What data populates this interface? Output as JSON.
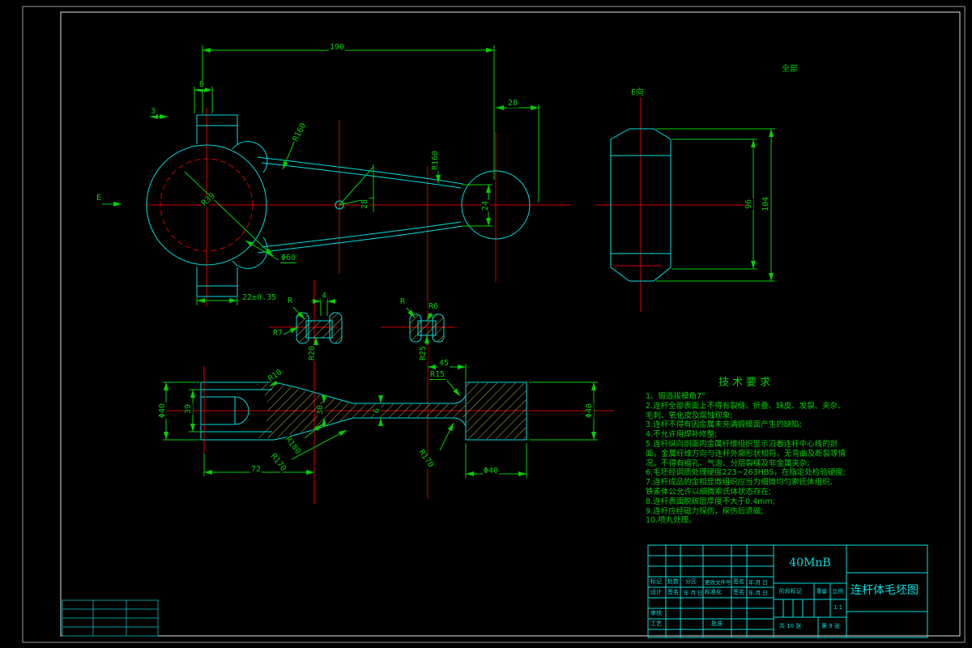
{
  "canvas": {
    "surface_note": "全部"
  },
  "front": {
    "len": "190",
    "boss_top": "8",
    "boss_step": "3",
    "small_off": "28",
    "big_boss": "22±0.35",
    "small_w": "24",
    "shank_taper": "28",
    "r_big": "R39",
    "r_shank_top": "R160",
    "r_shank_bot": "R160",
    "bore": "Φ60",
    "view_arrow": "E"
  },
  "eview": {
    "name": "E向",
    "across": "96",
    "total": "104"
  },
  "secl": {
    "r": "R",
    "web": "4",
    "r7": "R7",
    "r20": "R20"
  },
  "secr": {
    "r": "R",
    "r6": "R6",
    "r25": "R25"
  },
  "bottom": {
    "d_left": "Φ40",
    "fork": "39",
    "r10": "R10",
    "h1": "30",
    "h2": "6",
    "r180": "R180",
    "r170a": "R170",
    "span": "72",
    "off": "45",
    "r15": "R15",
    "r170b": "R170",
    "d_bot": "Φ40",
    "d_right": "Φ40"
  },
  "tech": {
    "title": "技术要求",
    "lines": [
      "1、锻造拔模角7°",
      "2.连杆全部表面上不得有裂缝、折叠、缺皮、发裂、夹杂、",
      "毛刺、氧化皮及腐蚀现象;",
      "3.连杆不得有因金属未充满锻模面产生的缺陷;",
      "4.不允许用焊补修整;",
      "5.连杆纵向剖面内金属纤维组织显示沿着连杆中心线的剖",
      "面，金属纤维方向与连杆外廓形状相符，无弯曲及断裂等情",
      "况。不得有缩孔、气泡、分层裂缝及非金属夹杂;",
      "6.毛坯经调质处理硬度223~263HBS，在指定处检验硬度;",
      "7.连杆成品的金相显微组织应当为细微均匀索氏体组织,",
      "铁素体公允许以细微索氏体状态存在;",
      "8.连杆表面脱碳层厚度不大于0.4mm;",
      "9.连杆应经磁力探伤，探伤后退磁;",
      "10.喷丸处理。"
    ]
  },
  "tb": {
    "material": "40MnB",
    "title": "连杆体毛坯图",
    "c1": "标记",
    "c2": "处数",
    "c3": "分区",
    "c4": "更改文件号",
    "c5": "签名",
    "c6": "年.月.日",
    "d1": "设计",
    "d2": "签名",
    "d3": "年 月 日",
    "d4": "标准化",
    "d5": "签名",
    "d6": "年.月.日",
    "audit": "审核",
    "process": "工艺",
    "approve": "批准",
    "stage": "阶段标记",
    "weight": "重量",
    "scale": "比例",
    "scale_v": "1:1",
    "total": "共 10 张",
    "page": "第 9 张"
  },
  "colors": {
    "outline": "#00dede",
    "centerline": "#d40000",
    "dimension": "#00cf00",
    "hatch": "#b8b845"
  }
}
